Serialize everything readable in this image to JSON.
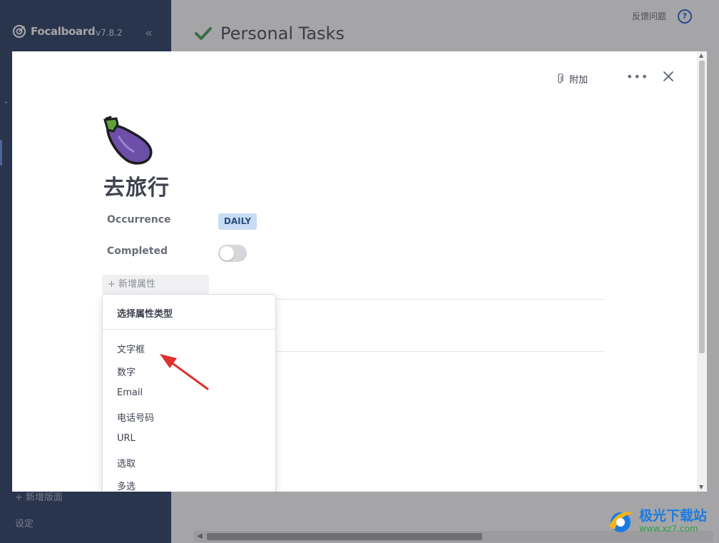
{
  "sidebar": {
    "app_name": "Focalboard",
    "version": "v7.8.2",
    "add_board": "+ 新增版面",
    "settings": "设定"
  },
  "header": {
    "board_title": "Personal Tasks",
    "feedback": "反馈问题",
    "help": "?"
  },
  "card": {
    "attach_label": "附加",
    "more": "•••",
    "title": "去旅行",
    "properties": [
      {
        "label": "Occurrence",
        "value": "DAILY"
      },
      {
        "label": "Completed",
        "value": ""
      }
    ],
    "add_property": "+ 新增属性"
  },
  "property_type_menu": {
    "header": "选择属性类型",
    "items": [
      "文字框",
      "数字",
      "Email",
      "电话号码",
      "URL",
      "选取",
      "多选"
    ]
  },
  "watermark": {
    "name": "极光下载站",
    "url": "www.xz7.com"
  },
  "colors": {
    "sidebar": "#1e325c",
    "accent": "#1c58d9",
    "badge_bg": "#c9dcf5",
    "check_green": "#3a9c4d",
    "annotation_red": "#e03030"
  }
}
